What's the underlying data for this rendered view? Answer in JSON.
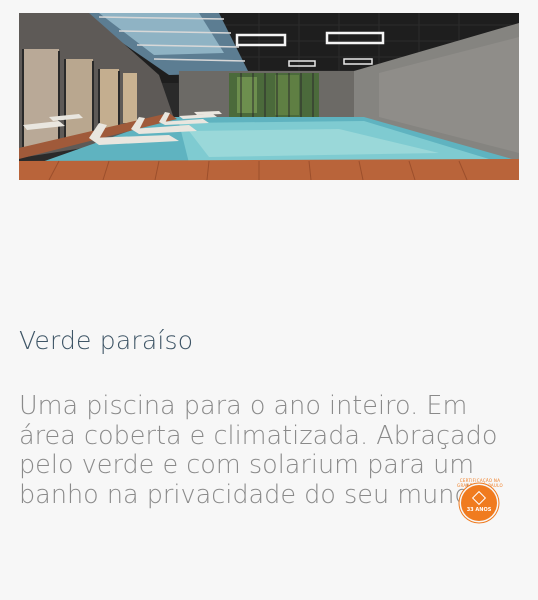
{
  "hero": {
    "image": "indoor-pool-photo"
  },
  "section": {
    "title": "Verde paraíso",
    "description": "Uma piscina para o ano inteiro. Em área coberta e climatizada. Abraçado pelo verde e com solarium para um banho na privacidade do seu mundo."
  },
  "badge": {
    "arc_text": "CERTIFICAÇÃO NA GRANDE SÃO PAULO",
    "label": "33 ANOS",
    "color": "#f07b1f"
  },
  "colors": {
    "title": "#3e5566",
    "body_text": "#8a8a8a",
    "background": "#f7f7f7"
  }
}
